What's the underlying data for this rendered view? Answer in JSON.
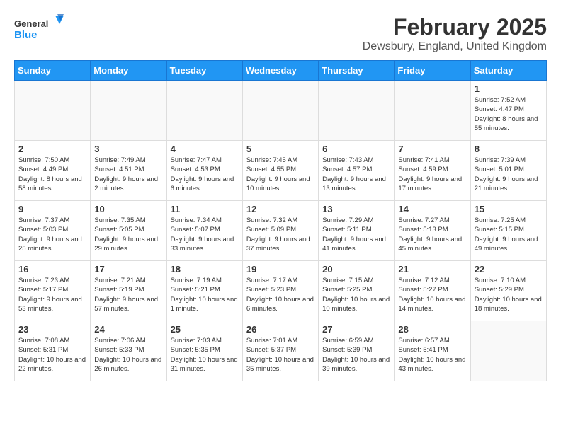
{
  "logo": {
    "line1": "General",
    "line2": "Blue"
  },
  "title": "February 2025",
  "location": "Dewsbury, England, United Kingdom",
  "days_of_week": [
    "Sunday",
    "Monday",
    "Tuesday",
    "Wednesday",
    "Thursday",
    "Friday",
    "Saturday"
  ],
  "weeks": [
    [
      {
        "day": "",
        "info": ""
      },
      {
        "day": "",
        "info": ""
      },
      {
        "day": "",
        "info": ""
      },
      {
        "day": "",
        "info": ""
      },
      {
        "day": "",
        "info": ""
      },
      {
        "day": "",
        "info": ""
      },
      {
        "day": "1",
        "info": "Sunrise: 7:52 AM\nSunset: 4:47 PM\nDaylight: 8 hours and 55 minutes."
      }
    ],
    [
      {
        "day": "2",
        "info": "Sunrise: 7:50 AM\nSunset: 4:49 PM\nDaylight: 8 hours and 58 minutes."
      },
      {
        "day": "3",
        "info": "Sunrise: 7:49 AM\nSunset: 4:51 PM\nDaylight: 9 hours and 2 minutes."
      },
      {
        "day": "4",
        "info": "Sunrise: 7:47 AM\nSunset: 4:53 PM\nDaylight: 9 hours and 6 minutes."
      },
      {
        "day": "5",
        "info": "Sunrise: 7:45 AM\nSunset: 4:55 PM\nDaylight: 9 hours and 10 minutes."
      },
      {
        "day": "6",
        "info": "Sunrise: 7:43 AM\nSunset: 4:57 PM\nDaylight: 9 hours and 13 minutes."
      },
      {
        "day": "7",
        "info": "Sunrise: 7:41 AM\nSunset: 4:59 PM\nDaylight: 9 hours and 17 minutes."
      },
      {
        "day": "8",
        "info": "Sunrise: 7:39 AM\nSunset: 5:01 PM\nDaylight: 9 hours and 21 minutes."
      }
    ],
    [
      {
        "day": "9",
        "info": "Sunrise: 7:37 AM\nSunset: 5:03 PM\nDaylight: 9 hours and 25 minutes."
      },
      {
        "day": "10",
        "info": "Sunrise: 7:35 AM\nSunset: 5:05 PM\nDaylight: 9 hours and 29 minutes."
      },
      {
        "day": "11",
        "info": "Sunrise: 7:34 AM\nSunset: 5:07 PM\nDaylight: 9 hours and 33 minutes."
      },
      {
        "day": "12",
        "info": "Sunrise: 7:32 AM\nSunset: 5:09 PM\nDaylight: 9 hours and 37 minutes."
      },
      {
        "day": "13",
        "info": "Sunrise: 7:29 AM\nSunset: 5:11 PM\nDaylight: 9 hours and 41 minutes."
      },
      {
        "day": "14",
        "info": "Sunrise: 7:27 AM\nSunset: 5:13 PM\nDaylight: 9 hours and 45 minutes."
      },
      {
        "day": "15",
        "info": "Sunrise: 7:25 AM\nSunset: 5:15 PM\nDaylight: 9 hours and 49 minutes."
      }
    ],
    [
      {
        "day": "16",
        "info": "Sunrise: 7:23 AM\nSunset: 5:17 PM\nDaylight: 9 hours and 53 minutes."
      },
      {
        "day": "17",
        "info": "Sunrise: 7:21 AM\nSunset: 5:19 PM\nDaylight: 9 hours and 57 minutes."
      },
      {
        "day": "18",
        "info": "Sunrise: 7:19 AM\nSunset: 5:21 PM\nDaylight: 10 hours and 1 minute."
      },
      {
        "day": "19",
        "info": "Sunrise: 7:17 AM\nSunset: 5:23 PM\nDaylight: 10 hours and 6 minutes."
      },
      {
        "day": "20",
        "info": "Sunrise: 7:15 AM\nSunset: 5:25 PM\nDaylight: 10 hours and 10 minutes."
      },
      {
        "day": "21",
        "info": "Sunrise: 7:12 AM\nSunset: 5:27 PM\nDaylight: 10 hours and 14 minutes."
      },
      {
        "day": "22",
        "info": "Sunrise: 7:10 AM\nSunset: 5:29 PM\nDaylight: 10 hours and 18 minutes."
      }
    ],
    [
      {
        "day": "23",
        "info": "Sunrise: 7:08 AM\nSunset: 5:31 PM\nDaylight: 10 hours and 22 minutes."
      },
      {
        "day": "24",
        "info": "Sunrise: 7:06 AM\nSunset: 5:33 PM\nDaylight: 10 hours and 26 minutes."
      },
      {
        "day": "25",
        "info": "Sunrise: 7:03 AM\nSunset: 5:35 PM\nDaylight: 10 hours and 31 minutes."
      },
      {
        "day": "26",
        "info": "Sunrise: 7:01 AM\nSunset: 5:37 PM\nDaylight: 10 hours and 35 minutes."
      },
      {
        "day": "27",
        "info": "Sunrise: 6:59 AM\nSunset: 5:39 PM\nDaylight: 10 hours and 39 minutes."
      },
      {
        "day": "28",
        "info": "Sunrise: 6:57 AM\nSunset: 5:41 PM\nDaylight: 10 hours and 43 minutes."
      },
      {
        "day": "",
        "info": ""
      }
    ]
  ]
}
